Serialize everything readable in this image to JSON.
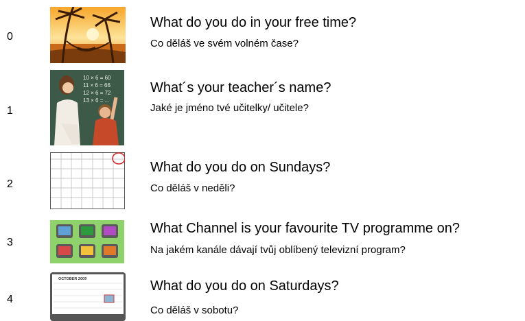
{
  "items": [
    {
      "index": "0",
      "question": "What do you do in your free time?",
      "answer": "Co děláš ve svém volném čase?",
      "image": "beach-hammock-sunset"
    },
    {
      "index": "1",
      "question": "What´s your teacher´s name?",
      "answer": "Jaké je jméno tvé učitelky/ učitele?",
      "image": "teacher-blackboard-math",
      "board_text": [
        "10 × 6 = 60",
        "11 × 6 = 66",
        "12 × 6 = 72",
        "13 × 6 = ..."
      ]
    },
    {
      "index": "2",
      "question": "What do you do on Sundays?",
      "answer": "Co děláš v neděli?",
      "image": "weekly-calendar-sunday-circled"
    },
    {
      "index": "3",
      "question": "What Channel is your favourite TV programme on?",
      "answer": "Na jakém kanále dávají tvůj oblíbený televizní program?",
      "image": "tv-sets-grid"
    },
    {
      "index": "4",
      "question": "What do you do on Saturdays?",
      "answer": "Co děláš v sobotu?",
      "image": "monthly-calendar",
      "calendar_title": "OCTOBER 2009"
    }
  ]
}
